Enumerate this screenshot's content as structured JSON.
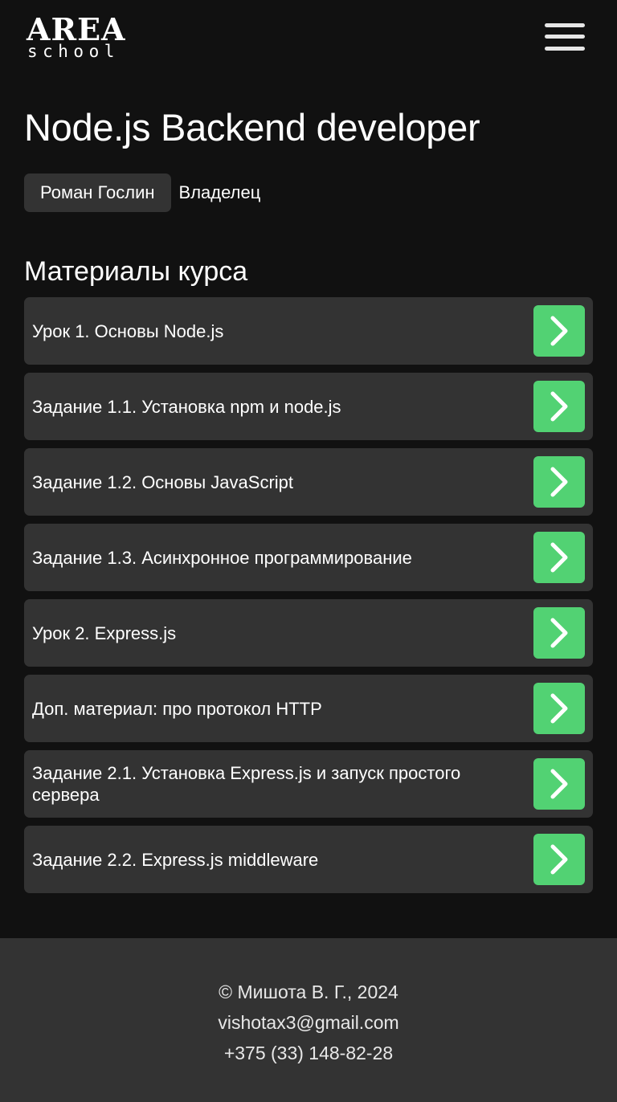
{
  "header": {
    "logo_top": "AREA",
    "logo_bottom": "school",
    "menu_icon": "hamburger-menu-icon"
  },
  "course": {
    "title": "Node.js Backend developer",
    "owner_name": "Роман Гослин",
    "owner_role": "Владелец"
  },
  "materials": {
    "title": "Материалы курса",
    "items": [
      {
        "label": "Урок 1. Основы Node.js"
      },
      {
        "label": "Задание 1.1. Установка npm и node.js"
      },
      {
        "label": "Задание 1.2. Основы JavaScript"
      },
      {
        "label": "Задание 1.3. Асинхронное программирование"
      },
      {
        "label": "Урок 2. Express.js"
      },
      {
        "label": "Доп. материал: про протокол HTTP"
      },
      {
        "label": "Задание 2.1. Установка Express.js и запуск простого сервера"
      },
      {
        "label": "Задание 2.2. Express.js middleware"
      }
    ],
    "open_icon": "chevron-right-icon"
  },
  "footer": {
    "copyright": "© Мишота В. Г., 2024",
    "email": "vishotax3@gmail.com",
    "phone": "+375 (33) 148-82-28"
  },
  "colors": {
    "background": "#111111",
    "card": "#333333",
    "accent": "#52d273",
    "text": "#ffffff"
  }
}
